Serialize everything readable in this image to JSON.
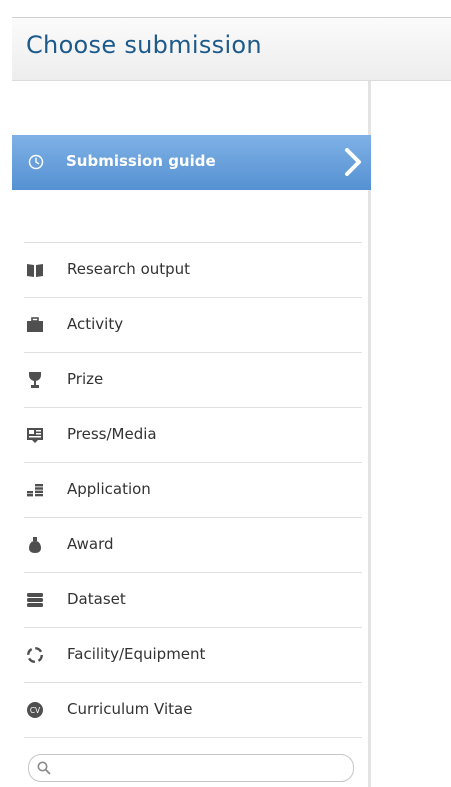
{
  "header": {
    "title": "Choose submission"
  },
  "guide": {
    "label": "Submission guide",
    "icon": "clock-icon"
  },
  "items": [
    {
      "label": "Research output",
      "icon": "book-icon"
    },
    {
      "label": "Activity",
      "icon": "briefcase-icon"
    },
    {
      "label": "Prize",
      "icon": "trophy-icon"
    },
    {
      "label": "Press/Media",
      "icon": "newspaper-icon"
    },
    {
      "label": "Application",
      "icon": "stacked-coins-icon"
    },
    {
      "label": "Award",
      "icon": "medal-icon"
    },
    {
      "label": "Dataset",
      "icon": "database-icon"
    },
    {
      "label": "Facility/Equipment",
      "icon": "facility-ring-icon"
    },
    {
      "label": "Curriculum Vitae",
      "icon": "cv-icon"
    }
  ],
  "search": {
    "placeholder": "",
    "value": ""
  },
  "colors": {
    "accent": "#5591d2",
    "title": "#1d5a8c",
    "icon": "#4f4f4f"
  }
}
